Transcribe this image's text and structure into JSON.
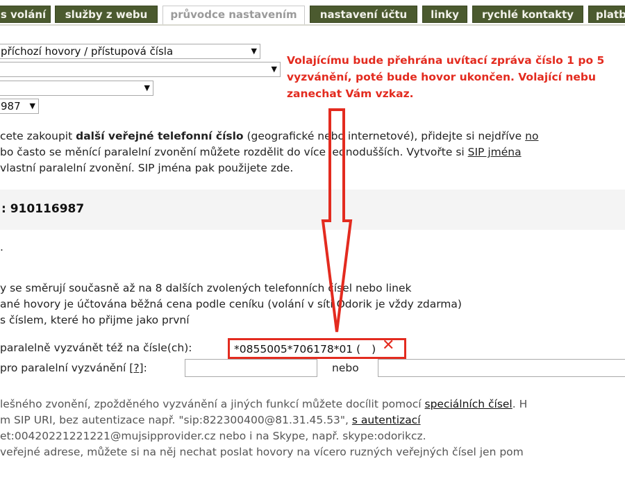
{
  "tabs": [
    {
      "label": "s volání"
    },
    {
      "label": "služby z webu"
    },
    {
      "label": "průvodce nastavením"
    },
    {
      "label": "nastavení účtu"
    },
    {
      "label": "linky"
    },
    {
      "label": "rychlé kontakty"
    },
    {
      "label": "platb"
    }
  ],
  "selects": {
    "first": "příchozí hovory / přístupová čísla",
    "fourth": "987"
  },
  "note": {
    "line1": "Volajícímu bude přehrána uvítací zpráva číslo 1 po 5",
    "line2": "vyzvánění, poté bude hovor ukončen. Volající nebu",
    "line3": "zanechat Vám vzkaz."
  },
  "intro": {
    "l1_a": "cete zakoupit ",
    "l1_b": "další veřejné telefonní číslo",
    "l1_c": " (geografické nebo internetové), přidejte si nejdříve ",
    "l1_link": "no",
    "l2_a": "bo často se měnící paralelní zvonění můžete rozdělit do více jednodušších. Vytvořte si ",
    "l2_link": "SIP jména",
    "l3": " vlastní paralelní zvonění. SIP jména pak použijete zde."
  },
  "band": {
    "number": ": 910116987"
  },
  "section_mark": ".",
  "desc": {
    "l1": "y se směrují současně až na 8 dalších zvolených telefonních čísel nebo linek",
    "l2": "ané hovory je účtována běžná cena podle ceníku (volání v síti Odorik je vždy zdarma)",
    "l3": "s číslem, které ho přijme jako první"
  },
  "form": {
    "label1": "paralelně vyzvánět též na čísle(ch):",
    "value1": "*0855005*706178*01 (",
    "value1_end": ")",
    "label2_a": " pro paralelní vyzvánění [",
    "label2_q": "?",
    "label2_b": "]:",
    "or": "nebo"
  },
  "lower": {
    "l1_a": "lešného zvonění, zpožděného vyzvánění a jiných funkcí můžete docílit pomocí ",
    "l1_link": "speciálních čísel",
    "l1_b": ". H",
    "l2_a": "m SIP URI, bez autentizace např. \"sip:822300400@81.31.45.53\", ",
    "l2_link": "s autentizací",
    "l3": "et:00420221221221@mujsipprovider.cz nebo i na Skype, např. skype:odorikcz.",
    "l4": "veřejné adrese, můžete si na něj nechat poslat hovory na vícero ruzných veřejných čísel jen pom"
  },
  "colors": {
    "tab_bg": "#4b5a2f",
    "annotation_red": "#e32b1f"
  }
}
